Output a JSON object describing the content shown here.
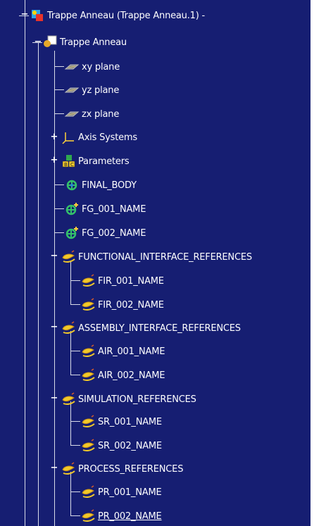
{
  "tree": {
    "root": {
      "label": "Trappe Anneau  (Trappe Anneau.1) -"
    },
    "part": {
      "label": "Trappe Anneau"
    },
    "items": [
      {
        "label": "xy plane"
      },
      {
        "label": "yz plane"
      },
      {
        "label": "zx plane"
      },
      {
        "label": "Axis Systems"
      },
      {
        "label": "Parameters"
      },
      {
        "label": "FINAL_BODY"
      },
      {
        "label": "FG_001_NAME"
      },
      {
        "label": "FG_002_NAME"
      },
      {
        "label": "FUNCTIONAL_INTERFACE_REFERENCES"
      },
      {
        "label": "FIR_001_NAME"
      },
      {
        "label": "FIR_002_NAME"
      },
      {
        "label": "ASSEMBLY_INTERFACE_REFERENCES"
      },
      {
        "label": "AIR_001_NAME"
      },
      {
        "label": "AIR_002_NAME"
      },
      {
        "label": "SIMULATION_REFERENCES"
      },
      {
        "label": "SR_001_NAME"
      },
      {
        "label": "SR_002_NAME"
      },
      {
        "label": "PROCESS_REFERENCES"
      },
      {
        "label": "PR_001_NAME"
      },
      {
        "label": "PR_002_NAME"
      }
    ]
  },
  "colors": {
    "background": "#161e72",
    "text": "#ffffff",
    "connector": "#d8dbe8"
  }
}
